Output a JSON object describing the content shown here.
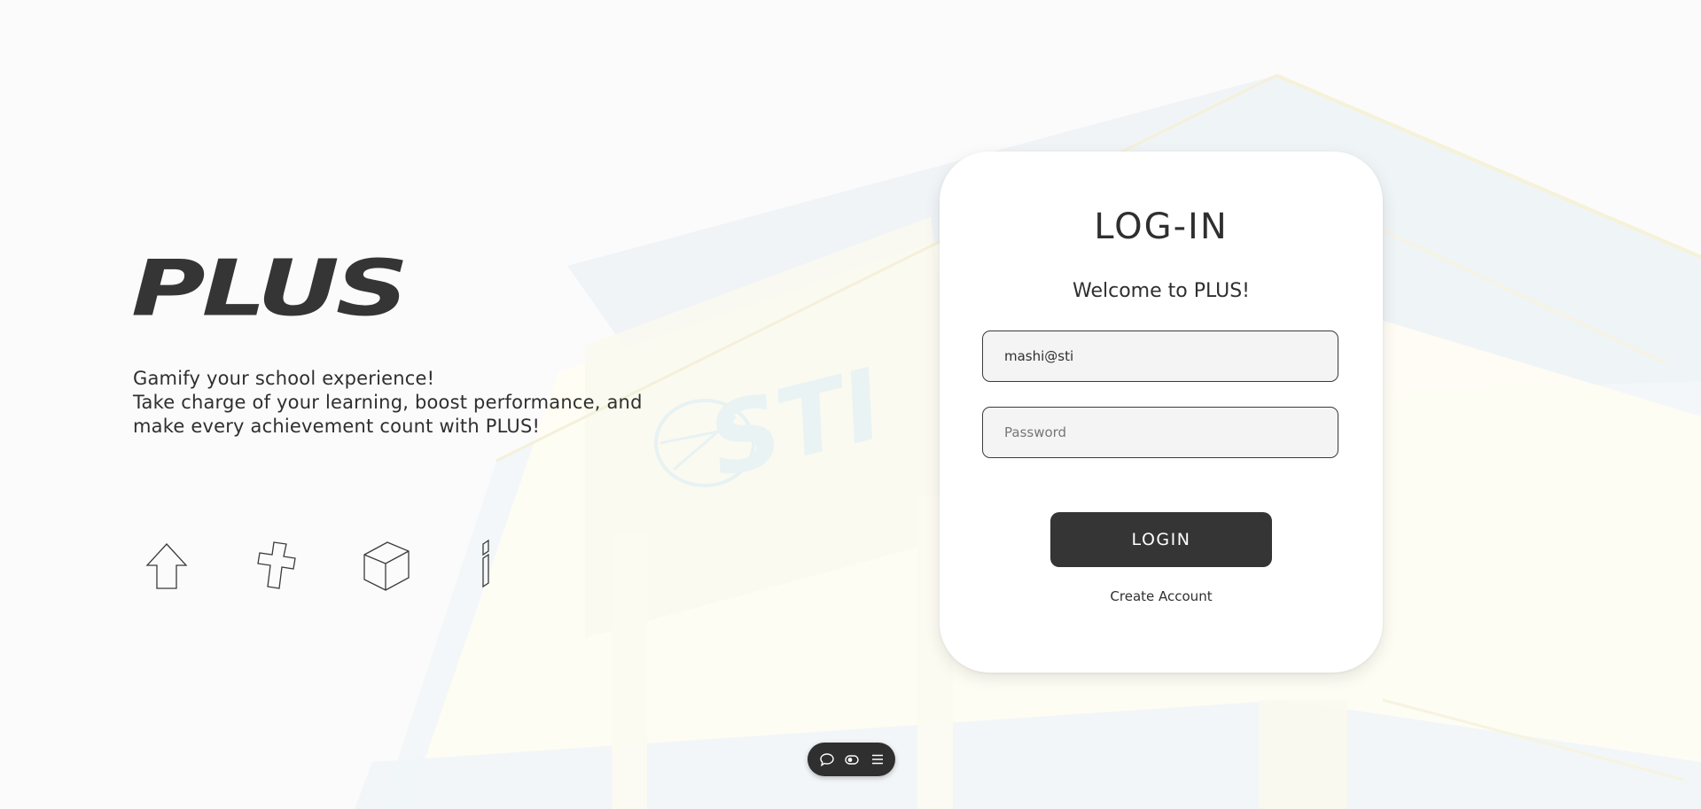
{
  "brand": {
    "logo_text": "PLUS",
    "colors": {
      "text": "#2f2f2f",
      "button": "#353535",
      "field_bg": "#f4f4f4"
    }
  },
  "hero": {
    "tagline_lines": [
      "Gamify your school experience!",
      "Take charge of your learning, boost performance, and",
      "make every achievement count with PLUS!"
    ],
    "feature_icons": [
      "arrow-up-icon",
      "plus-shape-icon",
      "cube-icon",
      "letter-i-icon"
    ]
  },
  "login_card": {
    "title": "LOG-IN",
    "welcome": "Welcome to PLUS!",
    "email_value": "mashi@sti",
    "password_placeholder": "Password",
    "login_label": "LOGIN",
    "create_account_label": "Create Account"
  },
  "background": {
    "building_sign_text": "STI"
  },
  "toolbar": {
    "icons": [
      "chat-bubble-icon",
      "toggle-icon",
      "menu-icon"
    ]
  }
}
